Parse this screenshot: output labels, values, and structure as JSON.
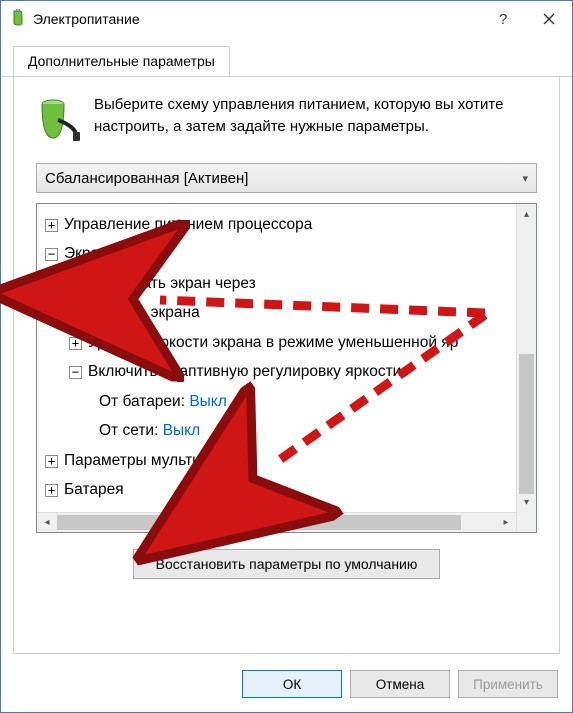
{
  "titlebar": {
    "title": "Электропитание"
  },
  "tab": {
    "label": "Дополнительные параметры"
  },
  "intro": {
    "text": "Выберите схему управления питанием, которую вы хотите настроить, а затем задайте нужные параметры."
  },
  "combo": {
    "selected": "Сбалансированная [Активен]"
  },
  "tree": {
    "cpu": "Управление питанием процессора",
    "screen": "Экран",
    "turnoff": "Отключать экран через",
    "brightness": "Яркость экрана",
    "dimlevel": "Уровень яркости экрана в режиме уменьшенной яр",
    "adaptive": "Включить адаптивную регулировку яркости",
    "battery_label": "От батареи: ",
    "battery_value": "Выкл",
    "plugged_label": "От сети: ",
    "plugged_value": "Выкл",
    "multimedia": "Параметры мультимедиа",
    "batterygrp": "Батарея"
  },
  "buttons": {
    "restore": "Восстановить параметры по умолчанию",
    "ok": "ОК",
    "cancel": "Отмена",
    "apply": "Применить"
  }
}
